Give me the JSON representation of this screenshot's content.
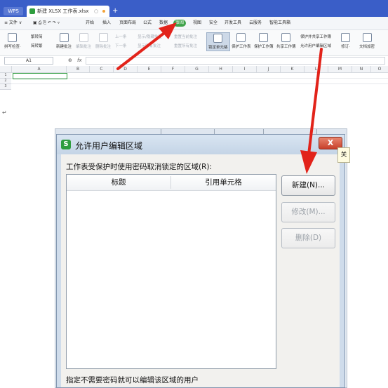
{
  "app": {
    "wps_label": "WPS",
    "doc_tab_title": "新建 XLSX 工作表.xlsx",
    "doc_tab_close": "○",
    "new_tab": "+"
  },
  "menubar": {
    "file": "≡ 文件 ∨",
    "items": [
      "开始",
      "插入",
      "页面布局",
      "公式",
      "数据",
      "审阅",
      "视图",
      "安全",
      "开发工具",
      "云服务",
      "智能工具箱"
    ],
    "active_index": 5
  },
  "ribbon": {
    "spellcheck": "拼写检查·",
    "trad_to_simp": "繁转简",
    "simp_to_trad": "简转繁",
    "new_comment": "新建批注",
    "edit_comment": "编辑批注",
    "delete_comment": "删除批注",
    "prev": "上一条",
    "next": "下一条",
    "show_hide_comment": "显示/隐藏批注",
    "show_all_comments": "显示所有批注",
    "reset_ink": "重置当前批注",
    "hide_ink": "重置所有批注",
    "lock_cell": "锁定单元格",
    "protect_sheet": "保护工作表",
    "protect_book": "保护工作簿",
    "share_book": "共享工作簿",
    "protect_share": "保护并共享工作簿",
    "allow_edit_ranges": "允许用户编辑区域",
    "track_changes": "修订·",
    "doc_encrypt": "文档加密"
  },
  "formula": {
    "name_box": "A1",
    "zoom_icon": "⊕",
    "fx": "fx"
  },
  "grid": {
    "columns": [
      "A",
      "B",
      "C",
      "D",
      "E",
      "F",
      "G",
      "H",
      "I",
      "J",
      "K",
      "L",
      "M",
      "N",
      "O"
    ],
    "rows": [
      "1",
      "2",
      "3"
    ]
  },
  "paragraph_mark": "↵",
  "dialog": {
    "logo": "S",
    "title": "允许用户编辑区域",
    "close_label": "X",
    "side_tip": "关",
    "unlocked_ranges_label": "工作表受保护时使用密码取消锁定的区域(R):",
    "columns": [
      "标题",
      "引用单元格"
    ],
    "new_button": "新建(N)...",
    "modify_button": "修改(M)...",
    "delete_button": "删除(D)",
    "no_password_label": "指定不需要密码就可以编辑该区域的用户"
  },
  "colors": {
    "tabbar": "#3a5ec8",
    "wps_green": "#2e9d3f",
    "arrow_red": "#e2231a",
    "close_red": "#c8402a"
  }
}
